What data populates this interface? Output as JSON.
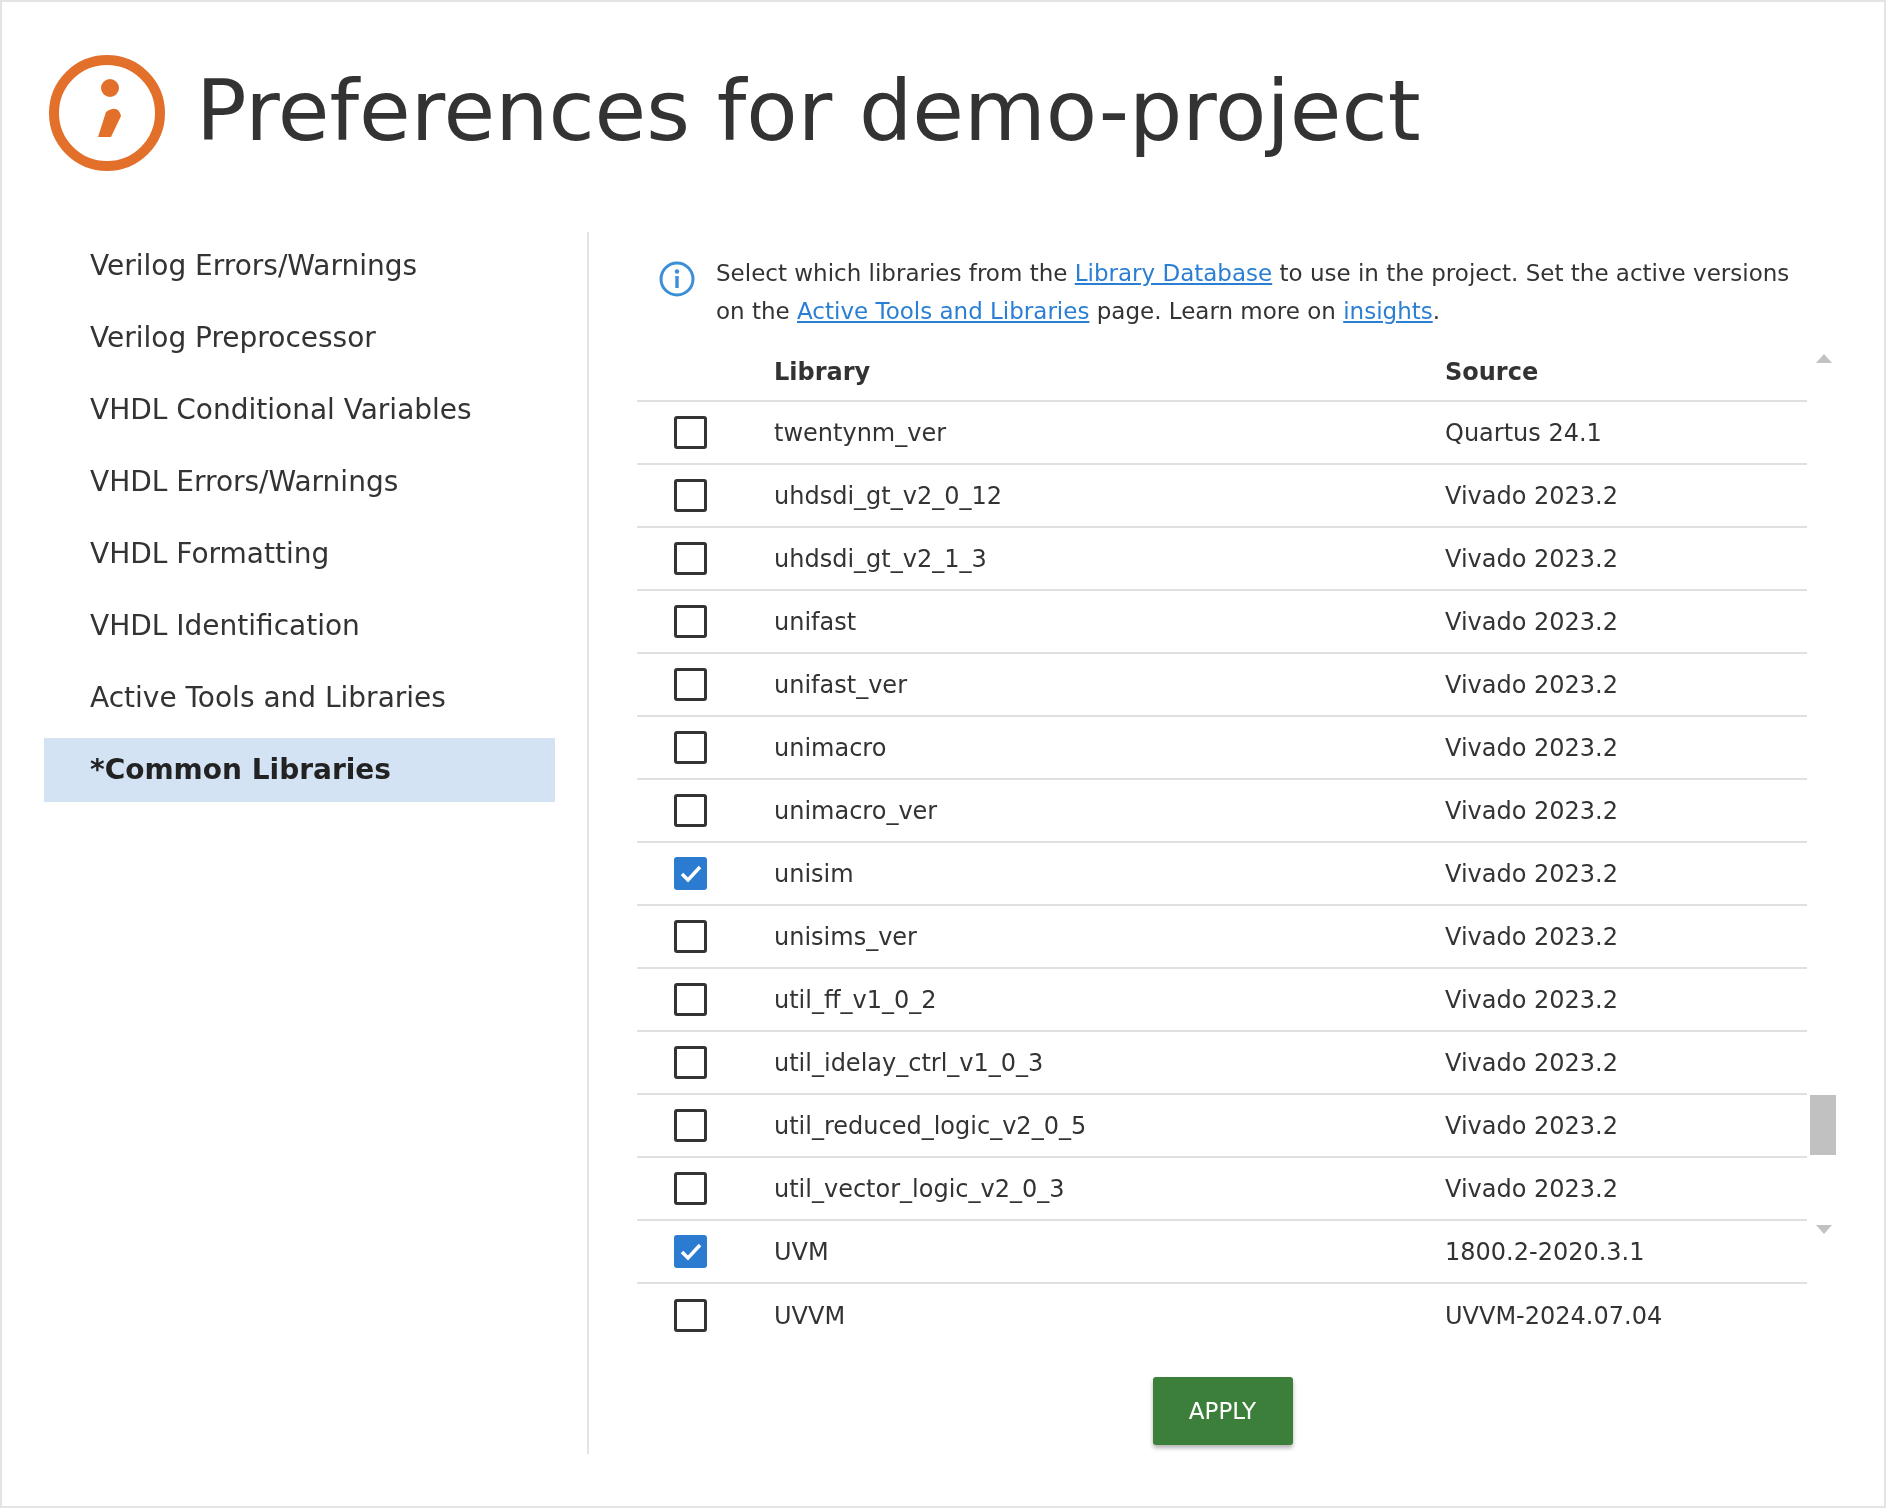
{
  "title": "Preferences for demo-project",
  "sidebar": {
    "items": [
      {
        "label": "Verilog Errors/Warnings",
        "selected": false
      },
      {
        "label": "Verilog Preprocessor",
        "selected": false
      },
      {
        "label": "VHDL Conditional Variables",
        "selected": false
      },
      {
        "label": "VHDL Errors/Warnings",
        "selected": false
      },
      {
        "label": "VHDL Formatting",
        "selected": false
      },
      {
        "label": "VHDL Identification",
        "selected": false
      },
      {
        "label": "Active Tools and Libraries",
        "selected": false
      },
      {
        "label": "*Common Libraries",
        "selected": true
      }
    ]
  },
  "info": {
    "parts": [
      {
        "kind": "text",
        "text": "Select which libraries from the "
      },
      {
        "kind": "link",
        "text": "Library Database"
      },
      {
        "kind": "text",
        "text": " to use in the project. Set the active versions on the "
      },
      {
        "kind": "link",
        "text": "Active Tools and Libraries"
      },
      {
        "kind": "text",
        "text": " page. Learn more on "
      },
      {
        "kind": "link",
        "text": "insights"
      },
      {
        "kind": "text",
        "text": "."
      }
    ]
  },
  "table": {
    "columns": [
      "Library",
      "Source"
    ],
    "rows": [
      {
        "library": "twentynm_ver",
        "source": "Quartus 24.1",
        "checked": false
      },
      {
        "library": "uhdsdi_gt_v2_0_12",
        "source": "Vivado 2023.2",
        "checked": false
      },
      {
        "library": "uhdsdi_gt_v2_1_3",
        "source": "Vivado 2023.2",
        "checked": false
      },
      {
        "library": "unifast",
        "source": "Vivado 2023.2",
        "checked": false
      },
      {
        "library": "unifast_ver",
        "source": "Vivado 2023.2",
        "checked": false
      },
      {
        "library": "unimacro",
        "source": "Vivado 2023.2",
        "checked": false
      },
      {
        "library": "unimacro_ver",
        "source": "Vivado 2023.2",
        "checked": false
      },
      {
        "library": "unisim",
        "source": "Vivado 2023.2",
        "checked": true
      },
      {
        "library": "unisims_ver",
        "source": "Vivado 2023.2",
        "checked": false
      },
      {
        "library": "util_ff_v1_0_2",
        "source": "Vivado 2023.2",
        "checked": false
      },
      {
        "library": "util_idelay_ctrl_v1_0_3",
        "source": "Vivado 2023.2",
        "checked": false
      },
      {
        "library": "util_reduced_logic_v2_0_5",
        "source": "Vivado 2023.2",
        "checked": false
      },
      {
        "library": "util_vector_logic_v2_0_3",
        "source": "Vivado 2023.2",
        "checked": false
      },
      {
        "library": "UVM",
        "source": "1800.2-2020.3.1",
        "checked": true
      },
      {
        "library": "UVVM",
        "source": "UVVM-2024.07.04",
        "checked": false
      }
    ]
  },
  "apply_button": "APPLY"
}
